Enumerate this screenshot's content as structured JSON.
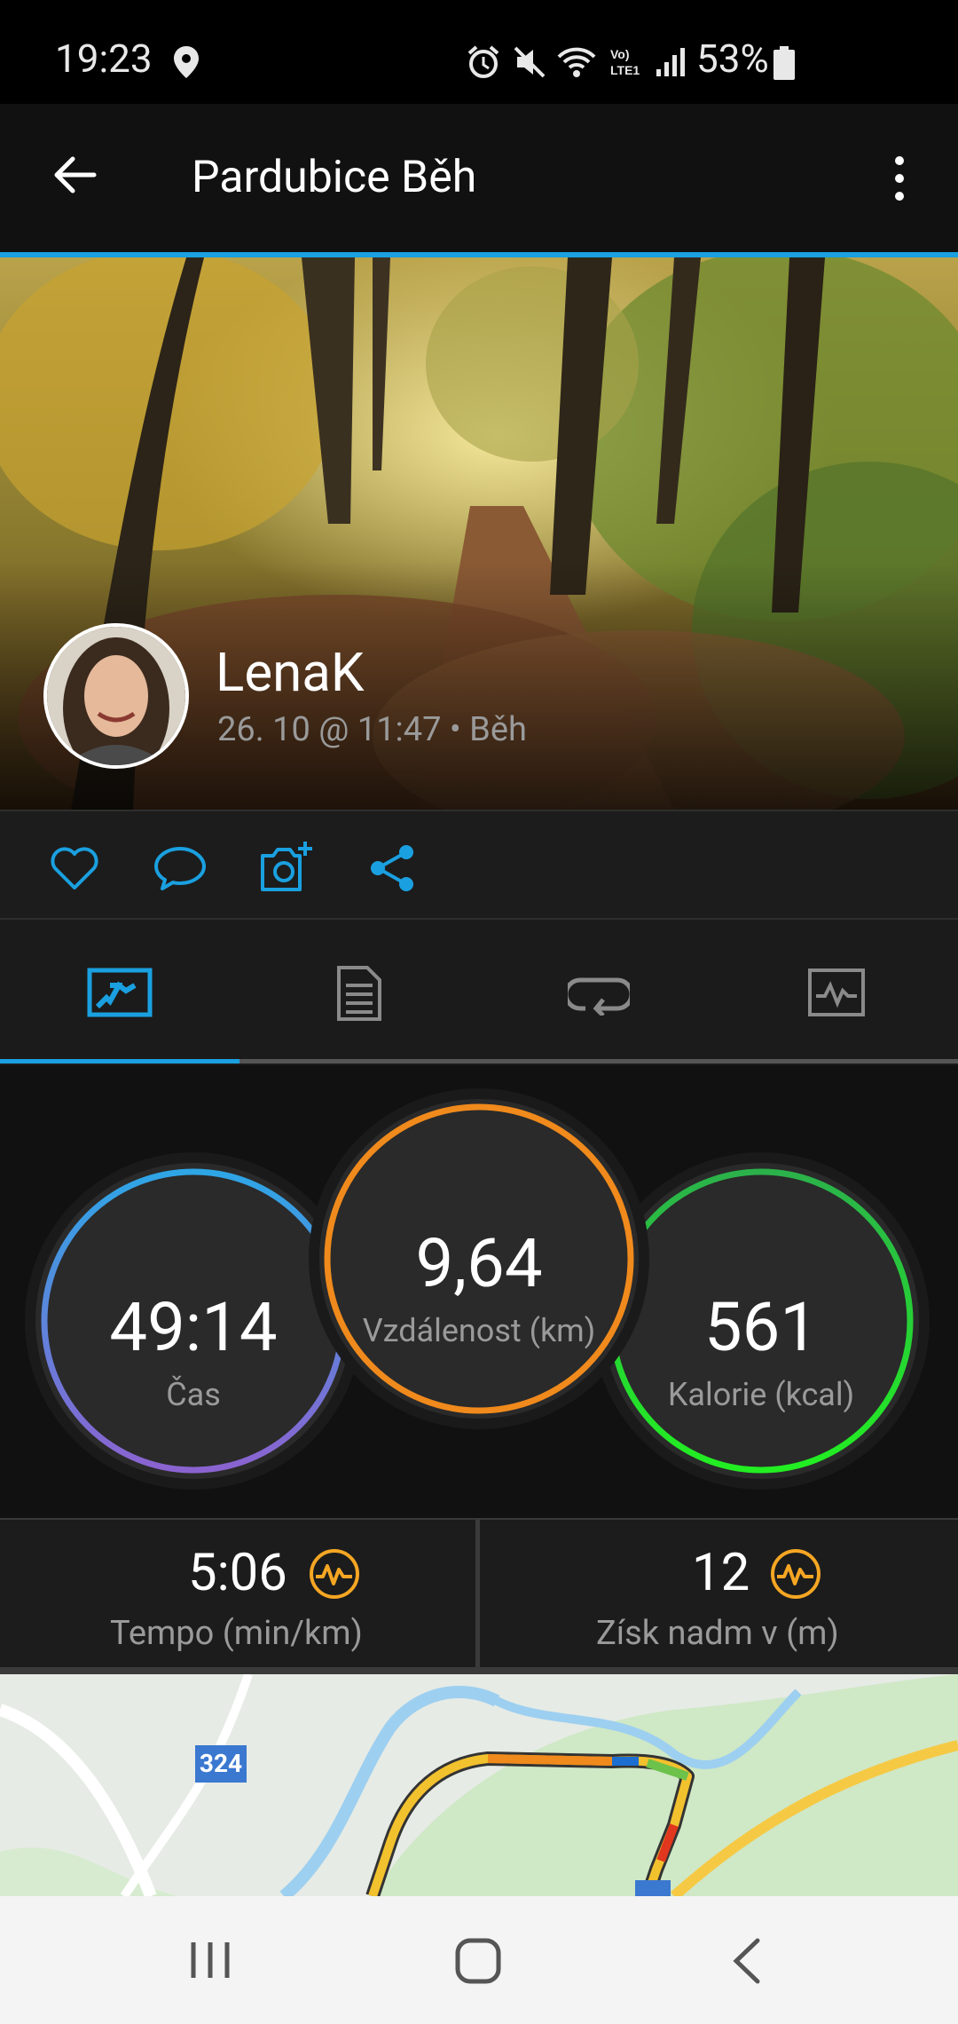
{
  "status_bar": {
    "time": "19:23",
    "battery_pct": "53%"
  },
  "app_bar": {
    "title": "Pardubice Běh"
  },
  "activity": {
    "user": "LenaK",
    "meta": "26. 10 @ 11:47 • Běh"
  },
  "stats": {
    "time": {
      "value": "49:14",
      "label": "Čas"
    },
    "distance": {
      "value": "9,64",
      "label": "Vzdálenost (km)"
    },
    "calories": {
      "value": "561",
      "label": "Kalorie (kcal)"
    }
  },
  "metrics": {
    "pace": {
      "value": "5:06",
      "label": "Tempo (min/km)"
    },
    "elevation": {
      "value": "12",
      "label": "Získ nadm v (m)"
    }
  },
  "map": {
    "road_label": "324"
  },
  "colors": {
    "accent": "#1aa0e0",
    "time_ring": "#5b7fd8",
    "distance_ring": "#f08a1c",
    "calories_ring": "#22d02e",
    "badge": "#f5a623"
  }
}
